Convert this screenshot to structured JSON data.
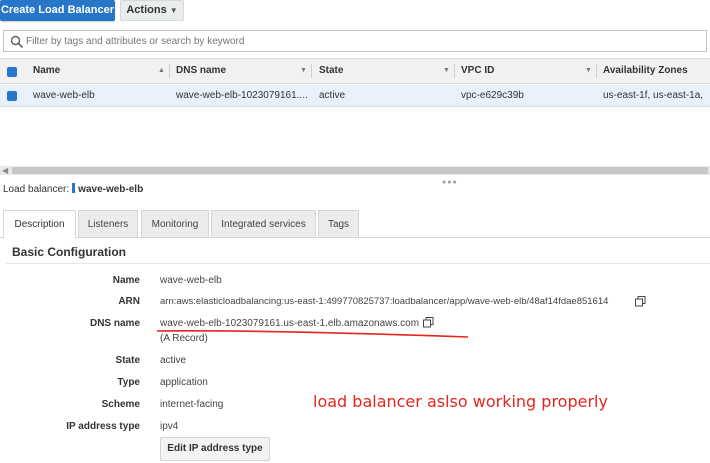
{
  "toolbar": {
    "create_label": "Create Load Balancer",
    "actions_label": "Actions"
  },
  "search": {
    "placeholder": "Filter by tags and attributes or search by keyword"
  },
  "table": {
    "columns": [
      "Name",
      "DNS name",
      "State",
      "VPC ID",
      "Availability Zones"
    ],
    "rows": [
      {
        "name": "wave-web-elb",
        "dns": "wave-web-elb-1023079161....",
        "state": "active",
        "vpc": "vpc-e629c39b",
        "az": "us-east-1f, us-east-1a,"
      }
    ]
  },
  "detail": {
    "prefix": "Load balancer:",
    "name": "wave-web-elb",
    "tabs": [
      "Description",
      "Listeners",
      "Monitoring",
      "Integrated services",
      "Tags"
    ],
    "active_tab": "Description",
    "section_title": "Basic Configuration",
    "fields": {
      "name_label": "Name",
      "name_value": "wave-web-elb",
      "arn_label": "ARN",
      "arn_value": "arn:aws:elasticloadbalancing:us-east-1:499770825737:loadbalancer/app/wave-web-elb/48af14fdae851614",
      "dns_label": "DNS name",
      "dns_value": "wave-web-elb-1023079161.us-east-1.elb.amazonaws.com",
      "dns_record": "(A Record)",
      "state_label": "State",
      "state_value": "active",
      "type_label": "Type",
      "type_value": "application",
      "scheme_label": "Scheme",
      "scheme_value": "internet-facing",
      "ip_label": "IP address type",
      "ip_value": "ipv4"
    },
    "edit_ip_label": "Edit IP address type"
  },
  "annotation": {
    "text": "load balancer aslso working properly",
    "color": "#e5261f"
  },
  "colors": {
    "primary": "#2876c9",
    "selected_row": "#e8f1fb"
  }
}
